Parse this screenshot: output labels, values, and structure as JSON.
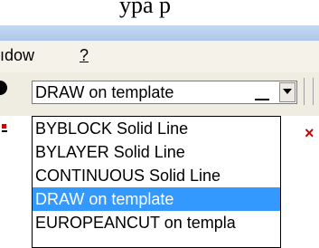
{
  "top_fragment": "ypa  p",
  "menu": {
    "window_label": "ıdow",
    "help_label": "?"
  },
  "linetype_select": {
    "value": "DRAW  on template"
  },
  "dropdown": {
    "options": [
      {
        "label": "BYBLOCK Solid Line",
        "selected": false
      },
      {
        "label": "BYLAYER Solid Line",
        "selected": false
      },
      {
        "label": "CONTINUOUS Solid Line",
        "selected": false
      },
      {
        "label": "DRAW  on template",
        "selected": true
      },
      {
        "label": "EUROPEANCUT  on templa",
        "selected": false
      }
    ]
  },
  "colors": {
    "selection": "#3399ff",
    "title_bar": "#b8d0ee",
    "close_cross": "#d00000"
  },
  "icons": {
    "right_toolbar_icon": "close-cross-icon",
    "dropdown_arrow": "chevron-down-icon"
  }
}
